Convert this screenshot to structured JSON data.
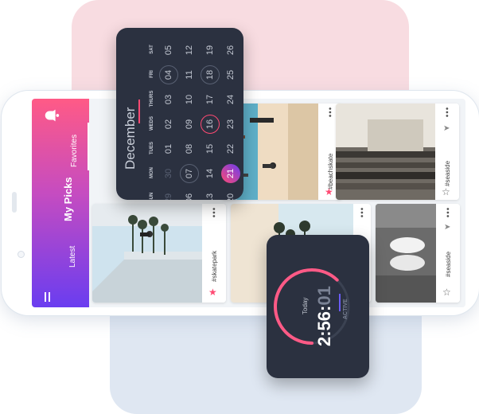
{
  "sidebar": {
    "title": "My Picks",
    "nav_favorites": "Favorites",
    "nav_latest": "Latest"
  },
  "cards": [
    {
      "tag": "#beachskate",
      "starred": true,
      "star_color": "#ff4a73"
    },
    {
      "tag": "#seaside",
      "starred": false
    },
    {
      "tag": "#skatepark",
      "starred": true,
      "star_color": "#ff4a73"
    },
    {
      "tag": "#seaside",
      "starred": false
    }
  ],
  "calendar": {
    "month": "December",
    "weekdays": [
      "SUN",
      "MON",
      "TUES",
      "WEDS",
      "THURS",
      "FRI",
      "SAT"
    ],
    "weeks": [
      [
        "29",
        "30",
        "01",
        "02",
        "03",
        "04",
        "05"
      ],
      [
        "06",
        "07",
        "08",
        "09",
        "10",
        "11",
        "12"
      ],
      [
        "13",
        "14",
        "15",
        "16",
        "17",
        "18",
        "19"
      ],
      [
        "20",
        "21",
        "22",
        "23",
        "24",
        "25",
        "26"
      ]
    ],
    "selected": "21",
    "accent": "#ff4a73"
  },
  "timer": {
    "label": "Today",
    "time_main": "2:56:",
    "time_seconds": "01",
    "status": "ACTIVE",
    "progress": 0.62,
    "ring_color": "#ff5a86",
    "status_color": "#6a5cf5"
  },
  "colors": {
    "sidebar_gradient_start": "#ff5a86",
    "sidebar_gradient_end": "#6a3df0",
    "card_dark": "#2b3140"
  }
}
